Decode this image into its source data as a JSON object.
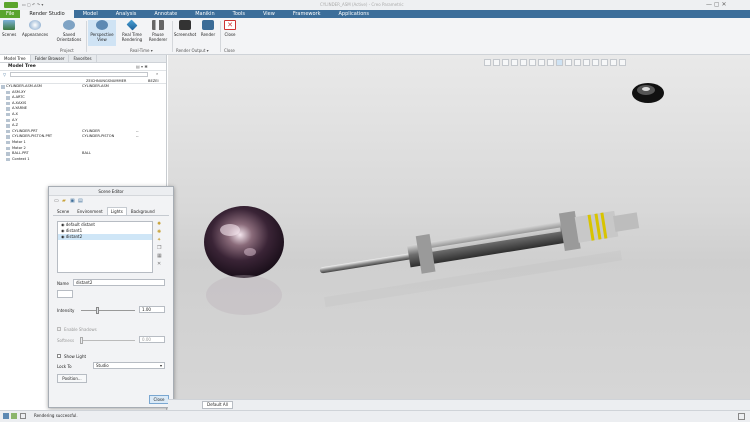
{
  "titlebar": {
    "text": "CYLINDER_ASM (Active) - Creo Parametric"
  },
  "ribbon_tabs": [
    "File",
    "Render Studio",
    "Model",
    "Analysis",
    "Annotate",
    "Manikin",
    "Tools",
    "View",
    "Framework",
    "Applications"
  ],
  "ribbon_buttons": {
    "scenes": "Scenes",
    "appearances": "Appearances",
    "saved_orientations": "Saved Orientations",
    "perspective_view": "Perspective View",
    "real_time_rendering": "Real Time Rendering",
    "pause_renderer": "Pause Renderer",
    "screenshot": "Screenshot",
    "render": "Render",
    "close": "Close"
  },
  "ribbon_groups": {
    "project": "Project",
    "real_time": "Real-Time ▾",
    "render_output": "Render Output ▾",
    "close": "Close"
  },
  "panel_tabs": [
    "Model Tree",
    "Folder Browser",
    "Favorites"
  ],
  "model_tree": {
    "title": "Model Tree",
    "col_headers": [
      "ZEICHNUNGSNUMMER",
      "BEZEI"
    ],
    "rows": [
      {
        "name": "CYLINDER-ASM.ASM",
        "c2": "CYLINDER-ASM",
        "c3": ""
      },
      {
        "name": "ASM-XY",
        "c2": "",
        "c3": ""
      },
      {
        "name": "A-ARTC",
        "c2": "",
        "c3": ""
      },
      {
        "name": "A-XAXIS",
        "c2": "",
        "c3": ""
      },
      {
        "name": "A-YARNE",
        "c2": "",
        "c3": ""
      },
      {
        "name": "A-X",
        "c2": "",
        "c3": ""
      },
      {
        "name": "A-Y",
        "c2": "",
        "c3": ""
      },
      {
        "name": "A-Z",
        "c2": "",
        "c3": ""
      },
      {
        "name": "CYLINDER.PRT",
        "c2": "CYLINDER",
        "c3": "--"
      },
      {
        "name": "CYLINDER-PISTON.PRT",
        "c2": "CYLINDER-PISTON",
        "c3": "--"
      },
      {
        "name": "Motor 1",
        "c2": "",
        "c3": ""
      },
      {
        "name": "Motor 2",
        "c2": "",
        "c3": ""
      },
      {
        "name": "BALL.PRT",
        "c2": "BALL",
        "c3": ""
      },
      {
        "name": "Context 1",
        "c2": "",
        "c3": ""
      }
    ]
  },
  "scene_editor": {
    "title": "Scene Editor",
    "tabs": [
      "Scene",
      "Environment",
      "Lights",
      "Background"
    ],
    "active_tab": "Lights",
    "lights": [
      "default distant",
      "distant1",
      "distant2"
    ],
    "selected_light": "distant2",
    "name_label": "Name",
    "name_value": "distant2",
    "intensity_label": "Intensity",
    "intensity_value": "1.00",
    "intensity_level": 0.3,
    "enable_shadows": "Enable Shadows",
    "softness_label": "Softness",
    "softness_value": "0.00",
    "softness_level": 0.0,
    "show_light": "Show Light",
    "lock_to_label": "Lock To",
    "lock_to_value": "Studio",
    "position_button": "Position...",
    "close_button": "Close"
  },
  "viewport_footer": {
    "filter": "Default All"
  },
  "status": {
    "message": "Rendering successful."
  },
  "colors": {
    "ribbon_blue": "#3c6e9a",
    "file_green": "#5aa42c",
    "selected_row": "#cfe6f7"
  }
}
